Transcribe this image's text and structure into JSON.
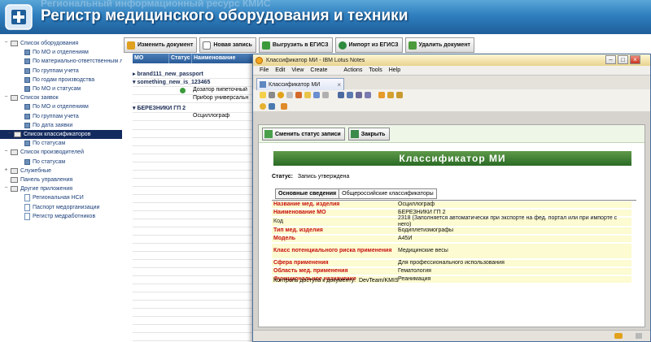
{
  "header": {
    "ghost_text": "Региональный информационный ресурс КМИС",
    "title": "Регистр медицинского оборудования и техники"
  },
  "sidebar": {
    "items": [
      {
        "label": "Список оборудования",
        "level": 0,
        "toggle": "−",
        "icon": "folder"
      },
      {
        "label": "По МО и отделениям",
        "level": 1,
        "icon": "dot"
      },
      {
        "label": "По материально-ответственным лицам",
        "level": 1,
        "icon": "dot"
      },
      {
        "label": "По группам учета",
        "level": 1,
        "icon": "dot"
      },
      {
        "label": "По годам производства",
        "level": 1,
        "icon": "dot"
      },
      {
        "label": "По МО и статусам",
        "level": 1,
        "icon": "dot"
      },
      {
        "label": "Список заявок",
        "level": 0,
        "toggle": "−",
        "icon": "folder"
      },
      {
        "label": "По МО и отделениям",
        "level": 1,
        "icon": "dot"
      },
      {
        "label": "По группам учета",
        "level": 1,
        "icon": "dot"
      },
      {
        "label": "По дата заявки",
        "level": 1,
        "icon": "dot"
      },
      {
        "label": "Список классификаторов",
        "level": 0,
        "toggle": "−",
        "icon": "folder",
        "selected": true
      },
      {
        "label": "По статусам",
        "level": 1,
        "icon": "dot"
      },
      {
        "label": "Список производителей",
        "level": 0,
        "toggle": "−",
        "icon": "folder"
      },
      {
        "label": "По статусам",
        "level": 1,
        "icon": "dot"
      },
      {
        "label": "Служебные",
        "level": 0,
        "toggle": "+",
        "icon": "gear"
      },
      {
        "label": "Панель управления",
        "level": 0,
        "icon": "tool"
      },
      {
        "label": "Другие приложения",
        "level": 0,
        "toggle": "−",
        "icon": "folder"
      },
      {
        "label": "Региональная НСИ",
        "level": 1,
        "icon": "doc"
      },
      {
        "label": "Паспорт медорганизации",
        "level": 1,
        "icon": "doc"
      },
      {
        "label": "Регистр медработников",
        "level": 1,
        "icon": "doc"
      }
    ]
  },
  "toolbar": {
    "buttons": [
      "Изменить документ",
      "Новая запись",
      "Выгрузить в ЕГИСЗ",
      "Импорт из ЕГИСЗ",
      "Удалить документ"
    ]
  },
  "view": {
    "columns": [
      "МО",
      "Статус",
      "Наименование"
    ],
    "rows": [
      {
        "text": "brand111_new_passport",
        "type": "category"
      },
      {
        "text": "something_new_is_123465",
        "type": "category"
      },
      {
        "text": "Дозатор пипеточный",
        "type": "doc",
        "status_icon": true
      },
      {
        "text": "Прибор универсальн",
        "type": "doc"
      },
      {
        "text": "БЕРЕЗНИКИ ГП 2",
        "type": "category"
      },
      {
        "text": "Осциллограф",
        "type": "doc"
      }
    ]
  },
  "window": {
    "title": "Классификатор МИ - IBM Lotus Notes",
    "menu": [
      "File",
      "Edit",
      "View",
      "Create",
      "Actions",
      "Tools",
      "Help"
    ],
    "tab_label": "Классификатор МИ",
    "actions": [
      "Сменить статус записи",
      "Закрыть"
    ],
    "form_header": "Классификатор МИ",
    "status_label": "Статус:",
    "status_value": "Запись утверждена",
    "form_tabs": [
      "Основные сведения",
      "Общероссийские классификаторы"
    ],
    "fields": [
      {
        "label": "Название мед. изделия",
        "value": "Осциллограф",
        "required": true
      },
      {
        "label": "Наименование МО",
        "value": "БЕРЕЗНИКИ ГП 2",
        "required": true
      },
      {
        "label": "Код",
        "value": "2318 (Заполняется автоматически при экспорте на фед. портал или при импорте с него)",
        "required": false
      },
      {
        "label": "Тип мед. изделия",
        "value": "Бодиплетизмографы",
        "required": true
      },
      {
        "label": "Модель",
        "value": "А45И",
        "required": true
      },
      {
        "label": "Класс потенциального риска применения",
        "value": "Медицинские весы",
        "required": true
      },
      {
        "label": "Сфера применения",
        "value": "Для профессионального использования",
        "required": true
      },
      {
        "label": "Область мед. применения",
        "value": "Гематология",
        "required": true
      },
      {
        "label": "Функциональное назначение",
        "value": "Реанимация",
        "required": true
      }
    ],
    "access_label": "Контроль доступа к документу:",
    "access_value": "DevTeam/KMIS"
  },
  "colors": {
    "header_blue": "#2f7fbf",
    "selected_nav": "#132a5e",
    "form_header_green": "#2a6a24",
    "required_label": "#c8100f",
    "field_bg": "#fcfbd1"
  }
}
